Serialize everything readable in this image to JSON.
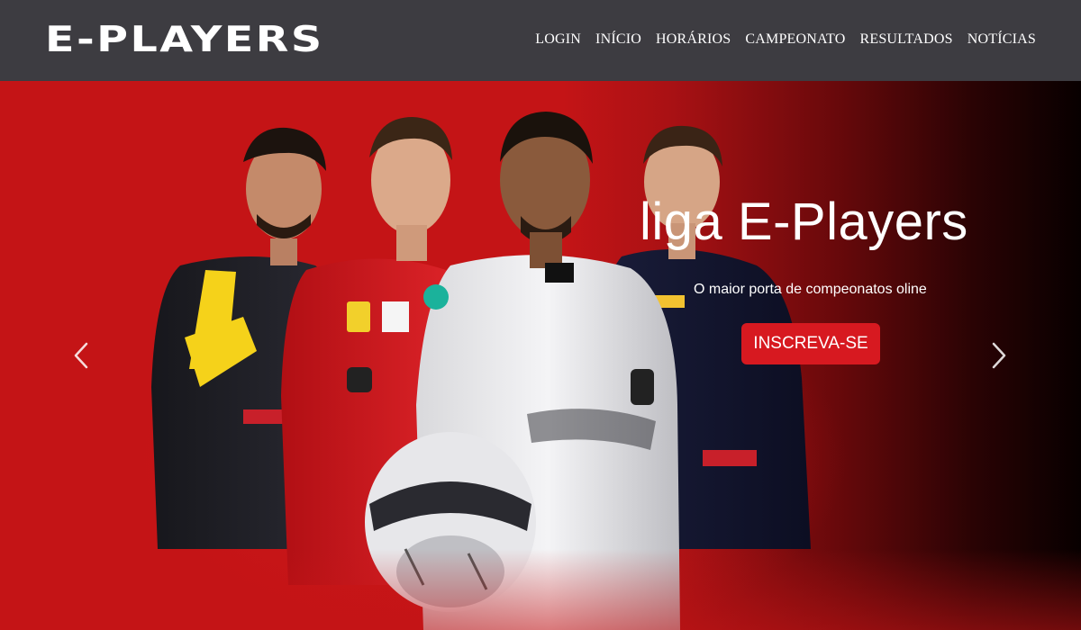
{
  "navbar": {
    "logo_text": "E-PLAYERS",
    "links": [
      {
        "label": "LOGIN"
      },
      {
        "label": "INÍCIO"
      },
      {
        "label": "HORÁRIOS"
      },
      {
        "label": "CAMPEONATO"
      },
      {
        "label": "RESULTADOS"
      },
      {
        "label": "NOTÍCIAS"
      }
    ]
  },
  "hero": {
    "title": "liga E-Players",
    "subtitle": "O maior porta de compeonatos oline",
    "cta_label": "INSCREVA-SE",
    "prev_icon": "chevron-left-icon",
    "next_icon": "chevron-right-icon"
  },
  "colors": {
    "navbar_bg": "#3d3c41",
    "hero_red": "#c41416",
    "cta_bg": "#d71920",
    "text": "#ffffff"
  }
}
